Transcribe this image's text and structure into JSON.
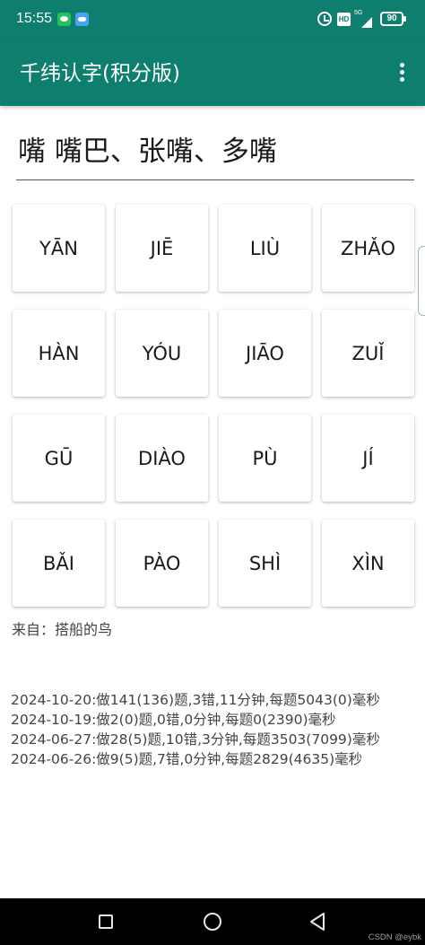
{
  "status_bar": {
    "time": "15:55",
    "signal": "5G",
    "battery": "90",
    "hd_badge": "HD",
    "icons": [
      "wechat-icon",
      "cloud-icon",
      "alarm-icon",
      "hd-icon",
      "signal-icon",
      "battery-icon"
    ]
  },
  "app_bar": {
    "title": "千纬认字(积分版)",
    "menu_icon": "more-vert-icon"
  },
  "question": {
    "text": "嘴 嘴巴、张嘴、多嘴"
  },
  "answers": [
    "YĀN",
    "JIĒ",
    "LIÙ",
    "ZHǍO",
    "HÀN",
    "YÓU",
    "JIĀO",
    "ZUǏ",
    "GŪ",
    "DIÀO",
    "PÙ",
    "JÍ",
    "BǍI",
    "PÀO",
    "SHÌ",
    "XÌN"
  ],
  "source": {
    "text": "来自：搭船的鸟"
  },
  "history": [
    "2024-10-20:做141(136)题,3错,11分钟,每题5043(0)毫秒",
    "2024-10-19:做2(0)题,0错,0分钟,每题0(2390)毫秒",
    "2024-06-27:做28(5)题,10错,3分钟,每题3503(7099)毫秒",
    "2024-06-26:做9(5)题,7错,0分钟,每题2829(4635)毫秒"
  ],
  "nav_bar": {
    "icons": [
      "recent-apps-icon",
      "home-icon",
      "back-icon"
    ]
  },
  "watermark": "CSDN @eybk",
  "colors": {
    "primary": "#0e7e6e",
    "background": "#ffffff",
    "text": "#1a1a1a",
    "secondary_text": "#444444",
    "nav_background": "#000000"
  }
}
